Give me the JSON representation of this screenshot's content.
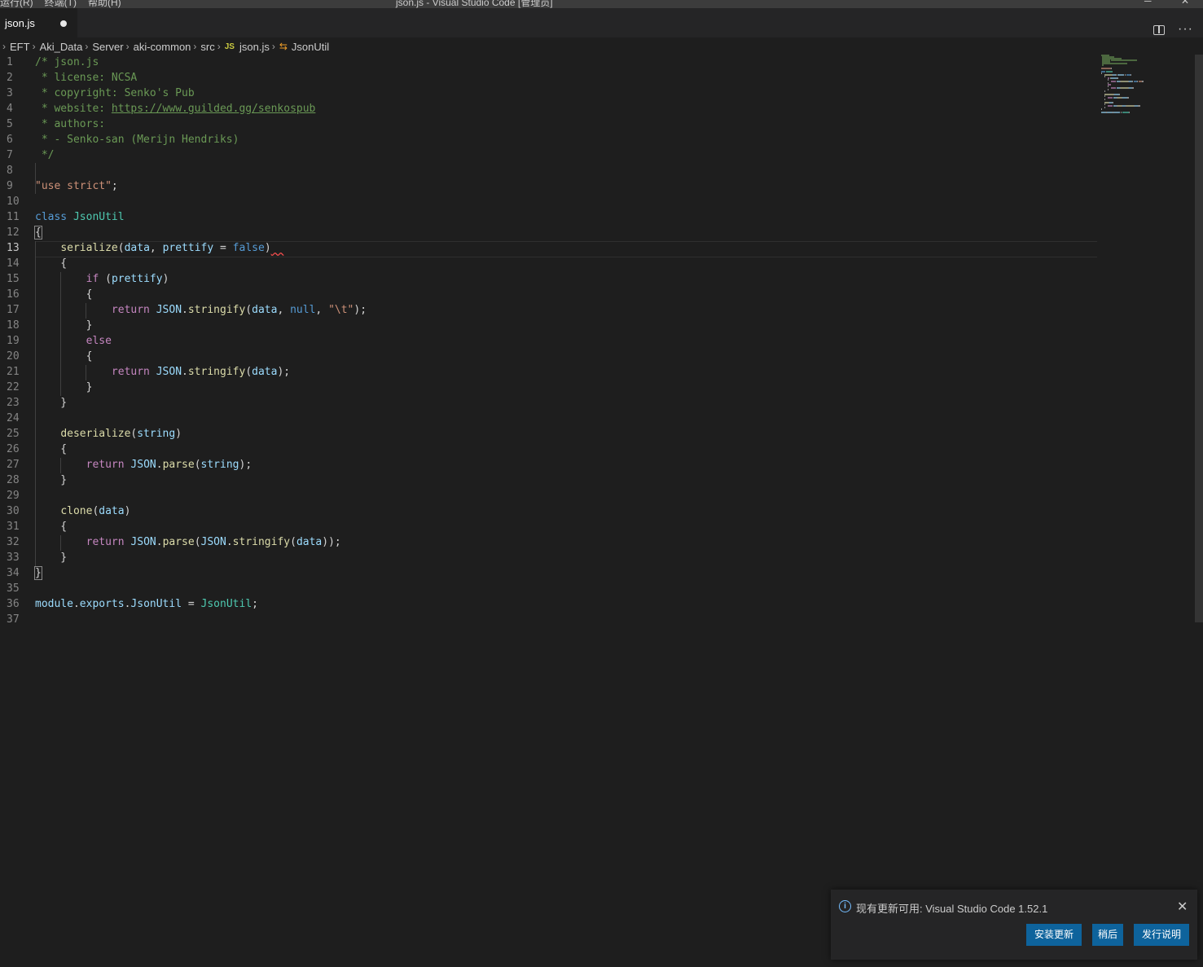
{
  "window": {
    "menu_items": [
      "运行(R)",
      "终端(T)",
      "帮助(H)"
    ],
    "title": "json.js - Visual Studio Code [管理员]",
    "controls": [
      "─",
      "□",
      "✕"
    ]
  },
  "tab": {
    "label": "json.js",
    "dirty": true
  },
  "editor_actions": {
    "split_icon": "split-editor-icon",
    "more_icon": "more-actions-icon",
    "more_glyph": "···"
  },
  "breadcrumb": {
    "items": [
      "EFT",
      "Aki_Data",
      "Server",
      "aki-common",
      "src"
    ],
    "file_badge": "JS",
    "file": "json.js",
    "symbol": "JsonUtil",
    "chevron": "›"
  },
  "editor": {
    "active_line": 13,
    "lines": [
      {
        "n": "1",
        "tokens": [
          [
            "com",
            "/* json.js"
          ]
        ]
      },
      {
        "n": "2",
        "tokens": [
          [
            "com",
            " * license: NCSA"
          ]
        ]
      },
      {
        "n": "3",
        "tokens": [
          [
            "com",
            " * copyright: Senko's Pub"
          ]
        ]
      },
      {
        "n": "4",
        "tokens": [
          [
            "com",
            " * website: "
          ],
          [
            "link",
            "https://www.guilded.gg/senkospub"
          ]
        ]
      },
      {
        "n": "5",
        "tokens": [
          [
            "com",
            " * authors:"
          ]
        ]
      },
      {
        "n": "6",
        "tokens": [
          [
            "com",
            " * - Senko-san (Merijn Hendriks)"
          ]
        ]
      },
      {
        "n": "7",
        "tokens": [
          [
            "com",
            " */"
          ]
        ]
      },
      {
        "n": "8",
        "tokens": []
      },
      {
        "n": "9",
        "tokens": [
          [
            "str",
            "\"use strict\""
          ],
          [
            "plain",
            ";"
          ]
        ]
      },
      {
        "n": "10",
        "tokens": []
      },
      {
        "n": "11",
        "tokens": [
          [
            "kw",
            "class "
          ],
          [
            "cls",
            "JsonUtil"
          ]
        ]
      },
      {
        "n": "12",
        "tokens": [
          [
            "bracket",
            "{"
          ]
        ]
      },
      {
        "n": "13",
        "tokens": [
          [
            "plain",
            "    "
          ],
          [
            "fn",
            "serialize"
          ],
          [
            "plain",
            "("
          ],
          [
            "var",
            "data"
          ],
          [
            "plain",
            ", "
          ],
          [
            "var",
            "prettify"
          ],
          [
            "plain",
            " = "
          ],
          [
            "kw",
            "false"
          ],
          [
            "plain",
            ")"
          ],
          [
            "squig",
            "  "
          ]
        ]
      },
      {
        "n": "14",
        "tokens": [
          [
            "plain",
            "    {"
          ]
        ]
      },
      {
        "n": "15",
        "tokens": [
          [
            "plain",
            "        "
          ],
          [
            "ctl",
            "if"
          ],
          [
            "plain",
            " ("
          ],
          [
            "var",
            "prettify"
          ],
          [
            "plain",
            ")"
          ]
        ]
      },
      {
        "n": "16",
        "tokens": [
          [
            "plain",
            "        {"
          ]
        ]
      },
      {
        "n": "17",
        "tokens": [
          [
            "plain",
            "            "
          ],
          [
            "ctl",
            "return "
          ],
          [
            "var",
            "JSON"
          ],
          [
            "plain",
            "."
          ],
          [
            "fn",
            "stringify"
          ],
          [
            "plain",
            "("
          ],
          [
            "var",
            "data"
          ],
          [
            "plain",
            ", "
          ],
          [
            "kw",
            "null"
          ],
          [
            "plain",
            ", "
          ],
          [
            "str",
            "\"\\t\""
          ],
          [
            "plain",
            ");"
          ]
        ]
      },
      {
        "n": "18",
        "tokens": [
          [
            "plain",
            "        }"
          ]
        ]
      },
      {
        "n": "19",
        "tokens": [
          [
            "plain",
            "        "
          ],
          [
            "ctl",
            "else"
          ]
        ]
      },
      {
        "n": "20",
        "tokens": [
          [
            "plain",
            "        {"
          ]
        ]
      },
      {
        "n": "21",
        "tokens": [
          [
            "plain",
            "            "
          ],
          [
            "ctl",
            "return "
          ],
          [
            "var",
            "JSON"
          ],
          [
            "plain",
            "."
          ],
          [
            "fn",
            "stringify"
          ],
          [
            "plain",
            "("
          ],
          [
            "var",
            "data"
          ],
          [
            "plain",
            ");"
          ]
        ]
      },
      {
        "n": "22",
        "tokens": [
          [
            "plain",
            "        }"
          ]
        ]
      },
      {
        "n": "23",
        "tokens": [
          [
            "plain",
            "    }"
          ]
        ]
      },
      {
        "n": "24",
        "tokens": []
      },
      {
        "n": "25",
        "tokens": [
          [
            "plain",
            "    "
          ],
          [
            "fn",
            "deserialize"
          ],
          [
            "plain",
            "("
          ],
          [
            "var",
            "string"
          ],
          [
            "plain",
            ")"
          ]
        ]
      },
      {
        "n": "26",
        "tokens": [
          [
            "plain",
            "    {"
          ]
        ]
      },
      {
        "n": "27",
        "tokens": [
          [
            "plain",
            "        "
          ],
          [
            "ctl",
            "return "
          ],
          [
            "var",
            "JSON"
          ],
          [
            "plain",
            "."
          ],
          [
            "fn",
            "parse"
          ],
          [
            "plain",
            "("
          ],
          [
            "var",
            "string"
          ],
          [
            "plain",
            ");"
          ]
        ]
      },
      {
        "n": "28",
        "tokens": [
          [
            "plain",
            "    }"
          ]
        ]
      },
      {
        "n": "29",
        "tokens": []
      },
      {
        "n": "30",
        "tokens": [
          [
            "plain",
            "    "
          ],
          [
            "fn",
            "clone"
          ],
          [
            "plain",
            "("
          ],
          [
            "var",
            "data"
          ],
          [
            "plain",
            ")"
          ]
        ]
      },
      {
        "n": "31",
        "tokens": [
          [
            "plain",
            "    {"
          ]
        ]
      },
      {
        "n": "32",
        "tokens": [
          [
            "plain",
            "        "
          ],
          [
            "ctl",
            "return "
          ],
          [
            "var",
            "JSON"
          ],
          [
            "plain",
            "."
          ],
          [
            "fn",
            "parse"
          ],
          [
            "plain",
            "("
          ],
          [
            "var",
            "JSON"
          ],
          [
            "plain",
            "."
          ],
          [
            "fn",
            "stringify"
          ],
          [
            "plain",
            "("
          ],
          [
            "var",
            "data"
          ],
          [
            "plain",
            "));"
          ]
        ]
      },
      {
        "n": "33",
        "tokens": [
          [
            "plain",
            "    }"
          ]
        ]
      },
      {
        "n": "34",
        "tokens": [
          [
            "bracket",
            "}"
          ]
        ]
      },
      {
        "n": "35",
        "tokens": []
      },
      {
        "n": "36",
        "tokens": [
          [
            "var",
            "module"
          ],
          [
            "plain",
            "."
          ],
          [
            "var",
            "exports"
          ],
          [
            "plain",
            "."
          ],
          [
            "var",
            "JsonUtil"
          ],
          [
            "plain",
            " = "
          ],
          [
            "cls",
            "JsonUtil"
          ],
          [
            "plain",
            ";"
          ]
        ]
      },
      {
        "n": "37",
        "tokens": []
      }
    ]
  },
  "notification": {
    "icon": "info-icon",
    "icon_glyph": "i",
    "message": "现有更新可用: Visual Studio Code 1.52.1",
    "close_glyph": "✕",
    "buttons": [
      "安装更新",
      "稍后",
      "发行说明"
    ]
  },
  "colors": {
    "background": "#1e1e1e",
    "tab_bar": "#252526",
    "button": "#0e639c",
    "comment": "#6a9955",
    "keyword": "#569cd6"
  }
}
